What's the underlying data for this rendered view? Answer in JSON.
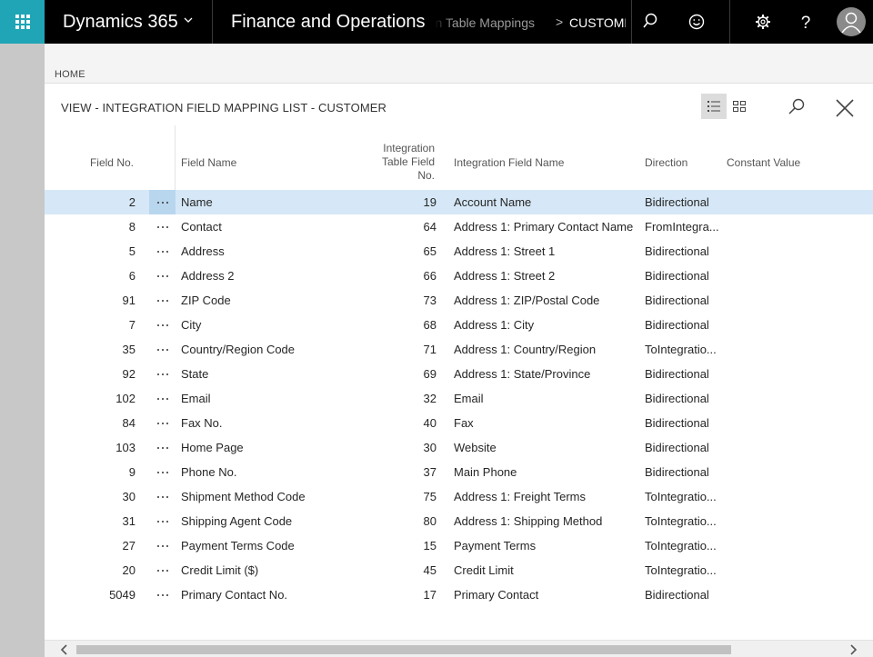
{
  "topbar": {
    "brand": "Dynamics 365",
    "app_name": "Finance and Operations",
    "breadcrumb_parent": "Integration Table Mappings",
    "breadcrumb_chevron": ">",
    "breadcrumb_current": "CUSTOMER"
  },
  "page": {
    "home_label": "HOME",
    "view_title": "VIEW - INTEGRATION FIELD MAPPING LIST - CUSTOMER"
  },
  "table": {
    "headers": {
      "field_no": "Field No.",
      "field_name": "Field Name",
      "int_field_no_line1": "Integration",
      "int_field_no_line2": "Table Field",
      "int_field_no_line3": "No.",
      "int_field_name": "Integration Field Name",
      "direction": "Direction",
      "constant_value": "Constant Value"
    },
    "rows": [
      {
        "no": "2",
        "name": "Name",
        "ino": "19",
        "iname": "Account Name",
        "dir": "Bidirectional"
      },
      {
        "no": "8",
        "name": "Contact",
        "ino": "64",
        "iname": "Address 1: Primary Contact Name",
        "dir": "FromIntegra..."
      },
      {
        "no": "5",
        "name": "Address",
        "ino": "65",
        "iname": "Address 1: Street 1",
        "dir": "Bidirectional"
      },
      {
        "no": "6",
        "name": "Address 2",
        "ino": "66",
        "iname": "Address 1: Street 2",
        "dir": "Bidirectional"
      },
      {
        "no": "91",
        "name": "ZIP Code",
        "ino": "73",
        "iname": "Address 1: ZIP/Postal Code",
        "dir": "Bidirectional"
      },
      {
        "no": "7",
        "name": "City",
        "ino": "68",
        "iname": "Address 1: City",
        "dir": "Bidirectional"
      },
      {
        "no": "35",
        "name": "Country/Region Code",
        "ino": "71",
        "iname": "Address 1: Country/Region",
        "dir": "ToIntegratio..."
      },
      {
        "no": "92",
        "name": "State",
        "ino": "69",
        "iname": "Address 1: State/Province",
        "dir": "Bidirectional"
      },
      {
        "no": "102",
        "name": "Email",
        "ino": "32",
        "iname": "Email",
        "dir": "Bidirectional"
      },
      {
        "no": "84",
        "name": "Fax No.",
        "ino": "40",
        "iname": "Fax",
        "dir": "Bidirectional"
      },
      {
        "no": "103",
        "name": "Home Page",
        "ino": "30",
        "iname": "Website",
        "dir": "Bidirectional"
      },
      {
        "no": "9",
        "name": "Phone No.",
        "ino": "37",
        "iname": "Main Phone",
        "dir": "Bidirectional"
      },
      {
        "no": "30",
        "name": "Shipment Method Code",
        "ino": "75",
        "iname": "Address 1: Freight Terms",
        "dir": "ToIntegratio..."
      },
      {
        "no": "31",
        "name": "Shipping Agent Code",
        "ino": "80",
        "iname": "Address 1: Shipping Method",
        "dir": "ToIntegratio..."
      },
      {
        "no": "27",
        "name": "Payment Terms Code",
        "ino": "15",
        "iname": "Payment Terms",
        "dir": "ToIntegratio..."
      },
      {
        "no": "20",
        "name": "Credit Limit ($)",
        "ino": "45",
        "iname": "Credit Limit",
        "dir": "ToIntegratio..."
      },
      {
        "no": "5049",
        "name": "Primary Contact No.",
        "ino": "17",
        "iname": "Primary Contact",
        "dir": "Bidirectional"
      }
    ],
    "selected_row": 0
  },
  "colors": {
    "waffle": "#1fa5b5",
    "topbar": "#000000",
    "selected_row": "#d6e8f7"
  },
  "icons": [
    "waffle-icon",
    "chevron-down-icon",
    "search-icon",
    "smiley-icon",
    "gear-icon",
    "help-icon",
    "avatar-icon",
    "list-view-icon",
    "tile-view-icon",
    "search-icon",
    "close-icon",
    "chevron-left-icon",
    "chevron-right-icon"
  ]
}
